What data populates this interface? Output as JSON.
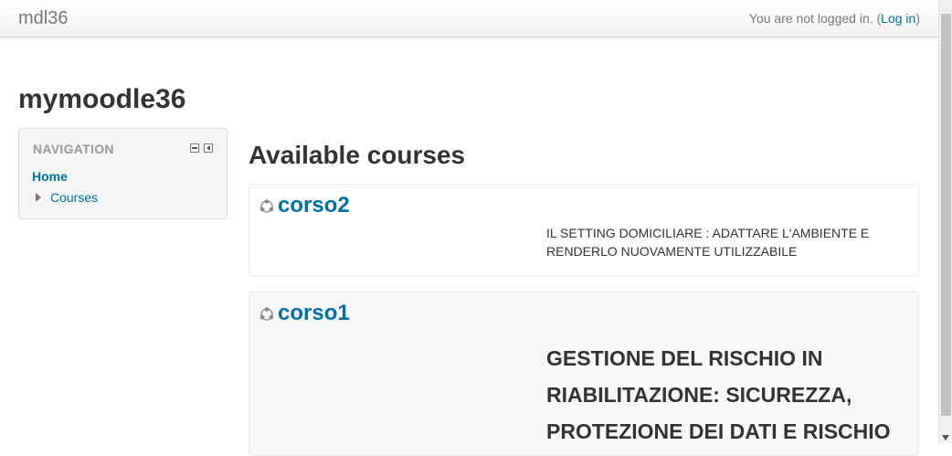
{
  "navbar": {
    "brand": "mdl36",
    "login_text": "You are not logged in. (",
    "login_link": "Log in",
    "login_close": ")"
  },
  "page": {
    "site_title": "mymoodle36",
    "available_title": "Available courses"
  },
  "navigation": {
    "title": "NAVIGATION",
    "home": "Home",
    "courses": "Courses"
  },
  "courses": [
    {
      "name": "corso2",
      "summary": "IL SETTING DOMICILIARE : ADATTARE L'AMBIENTE E RENDERLO NUOVAMENTE UTILIZZABILE"
    },
    {
      "name": "corso1",
      "summary": "GESTIONE DEL RISCHIO IN RIABILITAZIONE: SICUREZZA, PROTEZIONE DEI DATI E RISCHIO"
    }
  ],
  "colors": {
    "link": "#0070a8",
    "text": "#333333",
    "muted": "#777777"
  }
}
